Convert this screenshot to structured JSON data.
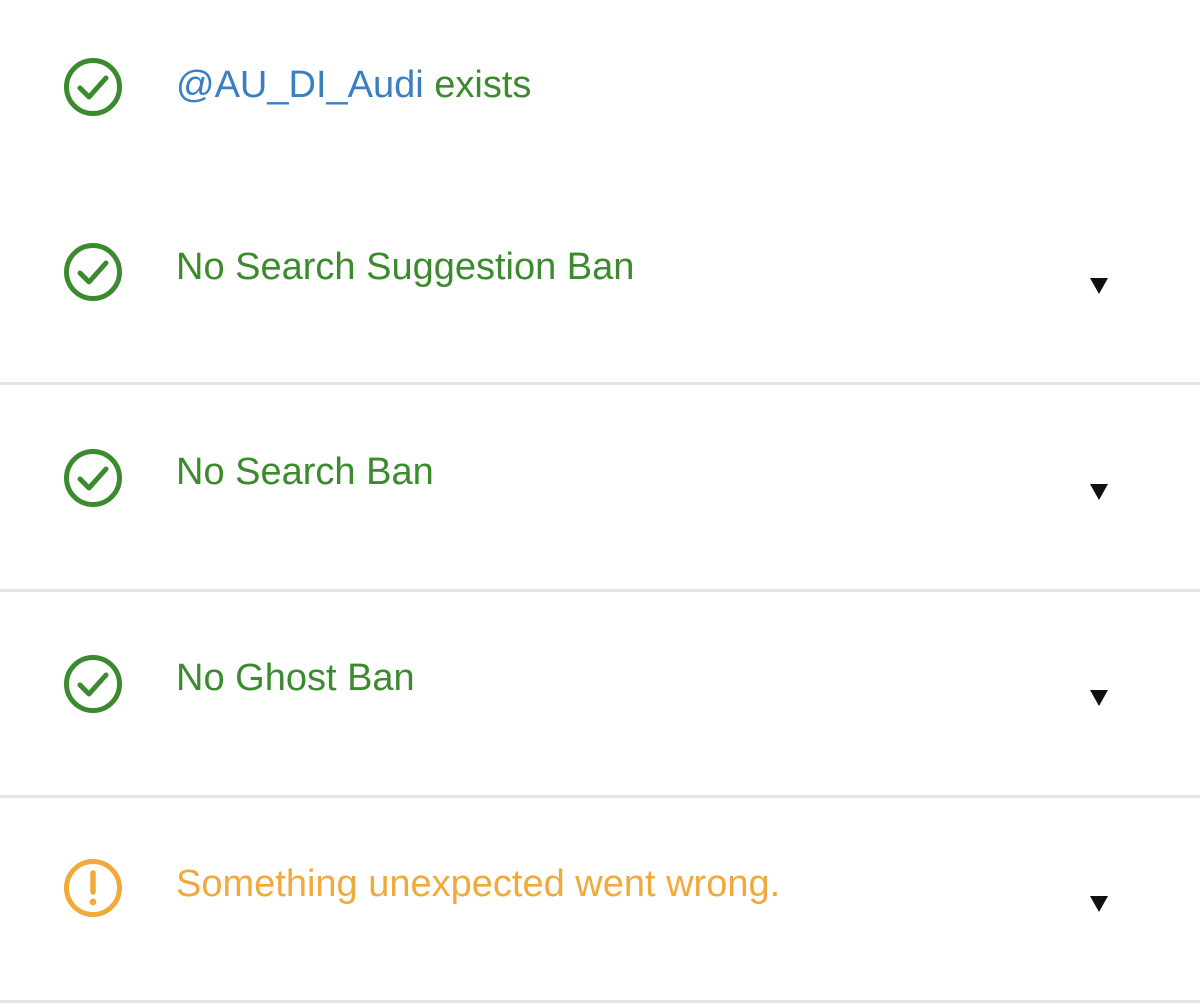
{
  "colors": {
    "success": "#3b8a2e",
    "handle": "#3a7fc1",
    "warning": "#f0a93a",
    "divider": "#e3e3ea"
  },
  "account": {
    "handle": "@AU_DI_Audi",
    "status_text": " exists",
    "icon": "check-circle-icon"
  },
  "checks": [
    {
      "label": "No Search Suggestion Ban",
      "status": "ok",
      "icon": "check-circle-icon",
      "expander": "chevron-down-icon"
    },
    {
      "label": "No Search Ban",
      "status": "ok",
      "icon": "check-circle-icon",
      "expander": "chevron-down-icon"
    },
    {
      "label": "No Ghost Ban",
      "status": "ok",
      "icon": "check-circle-icon",
      "expander": "chevron-down-icon"
    },
    {
      "label": "Something unexpected went wrong.",
      "status": "warning",
      "icon": "warning-circle-icon",
      "expander": "chevron-down-icon"
    }
  ]
}
